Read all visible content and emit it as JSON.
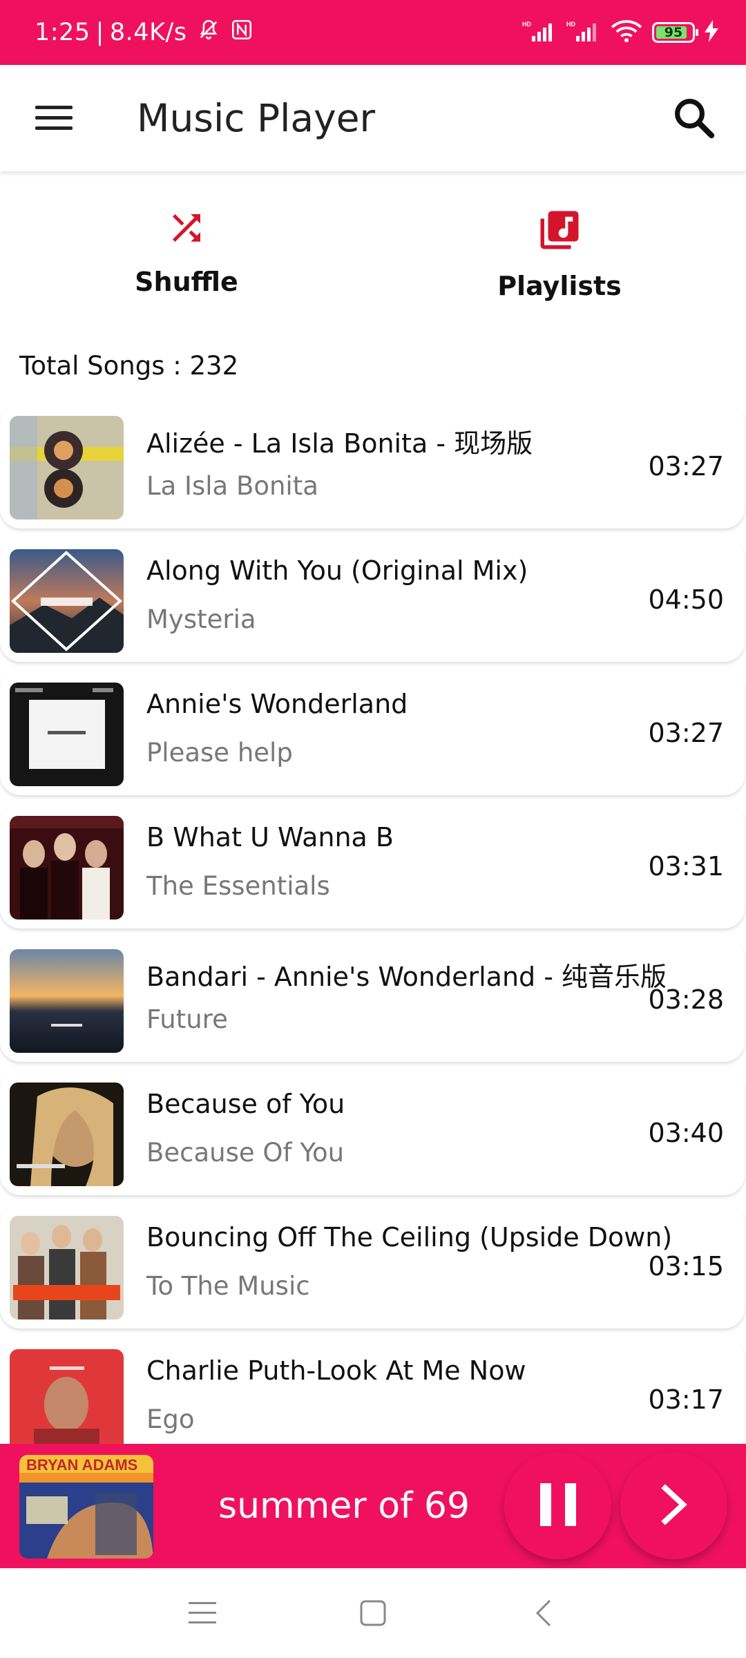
{
  "status_bar": {
    "time": "1:25",
    "network_speed": "8.4K/s",
    "battery": "95",
    "icons": [
      "mute-bell-icon",
      "nfc-icon",
      "hd-signal-icon",
      "wifi-icon",
      "charging-icon"
    ]
  },
  "app_bar": {
    "title": "Music Player",
    "menu_icon": "hamburger-menu-icon",
    "search_icon": "search-icon"
  },
  "actions": {
    "shuffle_label": "Shuffle",
    "playlists_label": "Playlists"
  },
  "total_songs": "Total Songs : 232",
  "songs": [
    {
      "title": "Alizée - La Isla Bonita - 现场版",
      "album": "La Isla Bonita",
      "duration": "03:27"
    },
    {
      "title": "Along With You (Original Mix)",
      "album": "Mysteria",
      "duration": "04:50"
    },
    {
      "title": "Annie's Wonderland",
      "album": "Please help",
      "duration": "03:27"
    },
    {
      "title": "B What U Wanna B",
      "album": "The Essentials",
      "duration": "03:31"
    },
    {
      "title": "Bandari - Annie's Wonderland - 纯音乐版",
      "album": "Future",
      "duration": "03:28"
    },
    {
      "title": "Because of You",
      "album": "Because Of You",
      "duration": "03:40"
    },
    {
      "title": "Bouncing Off The Ceiling (Upside Down)",
      "album": "To The Music",
      "duration": "03:15"
    },
    {
      "title": "Charlie Puth-Look At Me Now",
      "album": "Ego",
      "duration": "03:17"
    }
  ],
  "now_playing": {
    "title": "summer of 69",
    "art_text": "BRYAN ADAMS"
  },
  "colors": {
    "accent": "#F0115E",
    "icon_red": "#D4142B"
  }
}
